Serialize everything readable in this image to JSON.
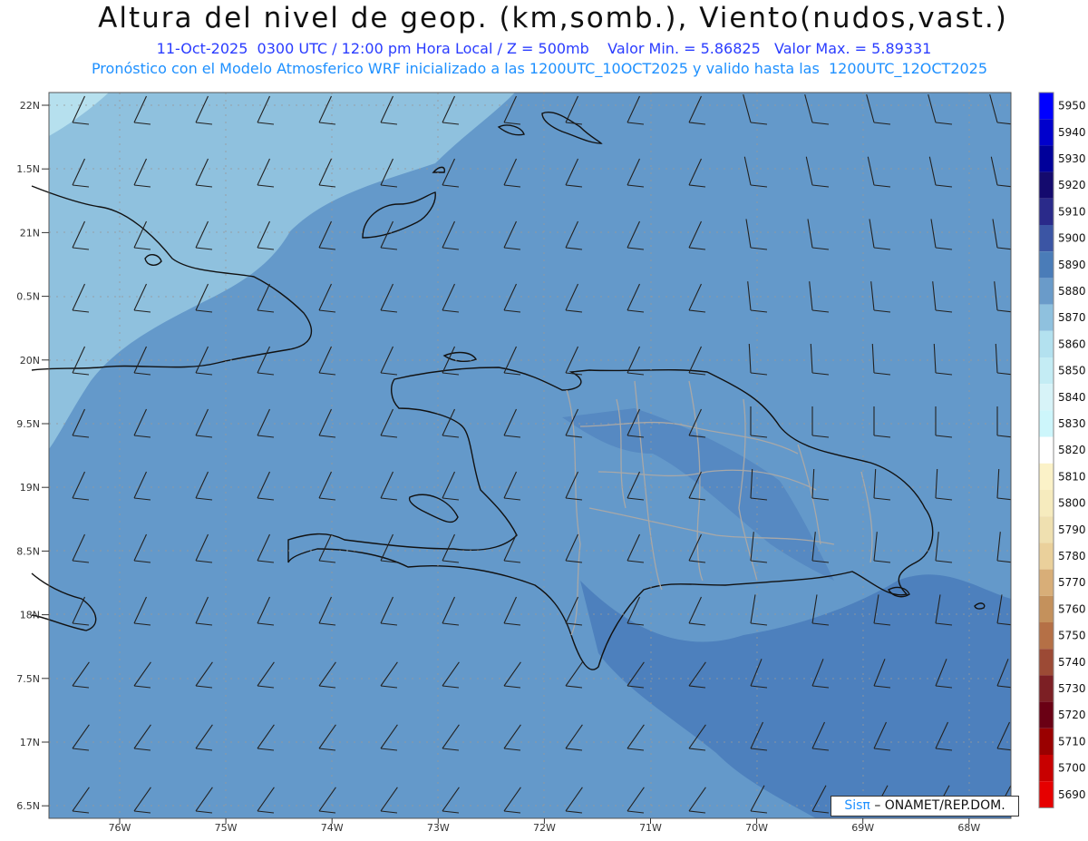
{
  "header": {
    "title": "Altura del nivel de geop. (km,somb.), Viento(nudos,vast.)",
    "subtitle": "11-Oct-2025  0300 UTC / 12:00 pm Hora Local / Z = 500mb    Valor Min. = 5.86825   Valor Max. = 5.89331",
    "model_line": "Pronóstico con el Modelo Atmosferico WRF inicializado a las 1200UTC_10OCT2025 y valido hasta las  1200UTC_12OCT2025"
  },
  "axes": {
    "lat_labels": [
      "22N",
      "1.5N",
      "21N",
      "0.5N",
      "20N",
      "9.5N",
      "19N",
      "8.5N",
      "18N",
      "7.5N",
      "17N",
      "6.5N"
    ],
    "lon_labels": [
      "76W",
      "75W",
      "74W",
      "73W",
      "72W",
      "71W",
      "70W",
      "69W",
      "68W"
    ]
  },
  "colorbar": {
    "levels": [
      "5950",
      "5940",
      "5930",
      "5920",
      "5910",
      "5900",
      "5890",
      "5880",
      "5870",
      "5860",
      "5850",
      "5840",
      "5830",
      "5820",
      "5810",
      "5800",
      "5790",
      "5780",
      "5770",
      "5760",
      "5750",
      "5740",
      "5730",
      "5720",
      "5710",
      "5700",
      "5690"
    ],
    "colors": [
      "#0000ff",
      "#0000cc",
      "#00009a",
      "#140a6e",
      "#2a2a8a",
      "#3b55a4",
      "#4a7cb8",
      "#6a9bc9",
      "#8fc1de",
      "#b3e1ef",
      "#c4ecf4",
      "#d7f3f8",
      "#cdf6fb",
      "#ffffff",
      "#fbf2c8",
      "#f6ebbe",
      "#efe0b0",
      "#ead09b",
      "#d8ae78",
      "#c4915c",
      "#b57046",
      "#9c4a35",
      "#7c1f24",
      "#6a0014",
      "#9a0000",
      "#c80000",
      "#e60000"
    ]
  },
  "credit": {
    "sis": "Sisπ",
    "text": "– ONAMET/REP.DOM."
  },
  "map_colors": {
    "deep": "#4d80bd",
    "mid": "#6499ca",
    "light": "#8fc1de",
    "pale": "#b6e0ee",
    "coast": "#111111",
    "province": "#a8a8a8"
  }
}
